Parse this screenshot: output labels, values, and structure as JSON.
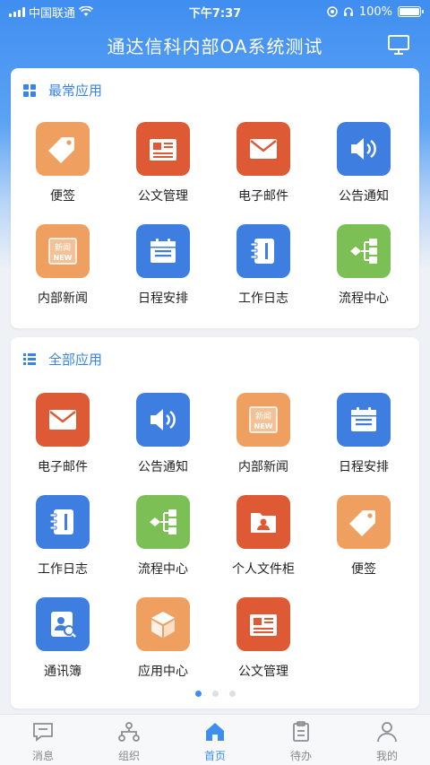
{
  "status_bar": {
    "carrier": "中国联通",
    "time": "下午7:37",
    "battery": "100%",
    "battery_level": 1.0
  },
  "header": {
    "title": "通达信科内部OA系统测试",
    "right_icon": "monitor-icon"
  },
  "frequent": {
    "title": "最常应用",
    "icon": "grid-icon",
    "apps": [
      {
        "label": "便签",
        "icon": "tag-icon",
        "color": "#efa060"
      },
      {
        "label": "公文管理",
        "icon": "document-icon",
        "color": "#dd5a35"
      },
      {
        "label": "电子邮件",
        "icon": "mail-icon",
        "color": "#dd5a35"
      },
      {
        "label": "公告通知",
        "icon": "speaker-icon",
        "color": "#3e7ee0"
      },
      {
        "label": "内部新闻",
        "icon": "news-icon",
        "color": "#efa060",
        "badge_text": "新闻",
        "badge_sub": "NEW"
      },
      {
        "label": "日程安排",
        "icon": "calendar-icon",
        "color": "#3e7ee0"
      },
      {
        "label": "工作日志",
        "icon": "notebook-icon",
        "color": "#3e7ee0"
      },
      {
        "label": "流程中心",
        "icon": "flow-icon",
        "color": "#7cbf54"
      }
    ]
  },
  "all_apps": {
    "title": "全部应用",
    "icon": "list-icon",
    "apps": [
      {
        "label": "电子邮件",
        "icon": "mail-icon",
        "color": "#dd5a35"
      },
      {
        "label": "公告通知",
        "icon": "speaker-icon",
        "color": "#3e7ee0"
      },
      {
        "label": "内部新闻",
        "icon": "news-icon",
        "color": "#efa060",
        "badge_text": "新闻",
        "badge_sub": "NEW"
      },
      {
        "label": "日程安排",
        "icon": "calendar-icon",
        "color": "#3e7ee0"
      },
      {
        "label": "工作日志",
        "icon": "notebook-icon",
        "color": "#3e7ee0"
      },
      {
        "label": "流程中心",
        "icon": "flow-icon",
        "color": "#7cbf54"
      },
      {
        "label": "个人文件柜",
        "icon": "folder-user-icon",
        "color": "#dd5a35"
      },
      {
        "label": "便签",
        "icon": "tag-icon",
        "color": "#efa060"
      },
      {
        "label": "通讯簿",
        "icon": "contact-card-icon",
        "color": "#3e7ee0"
      },
      {
        "label": "应用中心",
        "icon": "box-icon",
        "color": "#efa060"
      },
      {
        "label": "公文管理",
        "icon": "document-icon",
        "color": "#dd5a35"
      }
    ]
  },
  "pager": {
    "count": 3,
    "active": 0
  },
  "tabbar": [
    {
      "label": "消息",
      "icon": "message-icon",
      "active": false
    },
    {
      "label": "组织",
      "icon": "org-icon",
      "active": false
    },
    {
      "label": "首页",
      "icon": "home-icon",
      "active": true
    },
    {
      "label": "待办",
      "icon": "clipboard-icon",
      "active": false
    },
    {
      "label": "我的",
      "icon": "person-icon",
      "active": false
    }
  ],
  "colors": {
    "accent": "#3e8ef0",
    "orange": "#efa060",
    "red": "#dd5a35",
    "blue": "#3e7ee0",
    "green": "#7cbf54"
  }
}
